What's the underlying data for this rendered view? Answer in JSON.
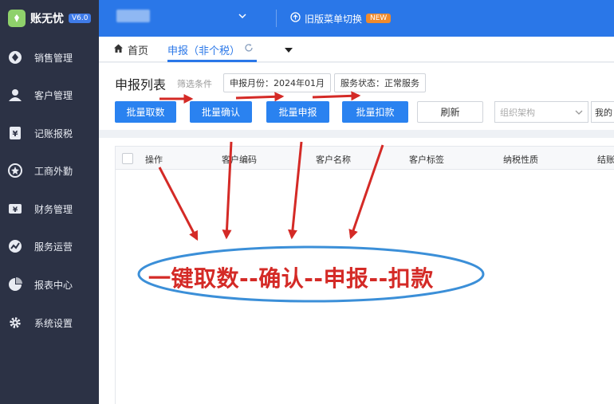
{
  "app": {
    "name": "账无忧",
    "version": "V6.0"
  },
  "sidebar": {
    "items": [
      {
        "label": "销售管理",
        "icon": "sales-icon"
      },
      {
        "label": "客户管理",
        "icon": "customer-icon"
      },
      {
        "label": "记账报税",
        "icon": "tax-icon"
      },
      {
        "label": "工商外勤",
        "icon": "field-icon"
      },
      {
        "label": "财务管理",
        "icon": "finance-icon"
      },
      {
        "label": "服务运营",
        "icon": "operations-icon"
      },
      {
        "label": "报表中心",
        "icon": "report-icon"
      },
      {
        "label": "系统设置",
        "icon": "settings-icon"
      }
    ]
  },
  "header": {
    "old_menu_label": "旧版菜单切换",
    "new_badge": "NEW"
  },
  "tabs": {
    "home": "首页",
    "active": "申报（非个税）"
  },
  "page": {
    "title": "申报列表",
    "filter_label": "筛选条件",
    "filter_month": "申报月份：2024年01月",
    "filter_status": "服务状态：正常服务"
  },
  "toolbar": {
    "batch_fetch": "批量取数",
    "batch_confirm": "批量确认",
    "batch_declare": "批量申报",
    "batch_deduct": "批量扣款",
    "refresh": "刷新",
    "org_placeholder": "组织架构",
    "mine_label": "我的"
  },
  "table": {
    "columns": [
      "操作",
      "客户编码",
      "客户名称",
      "客户标签",
      "纳税性质",
      "结账"
    ]
  },
  "annotation": {
    "text": "一键取数--确认--申报--扣款"
  },
  "colors": {
    "primary": "#2a77e8",
    "sidebar": "#2c3245",
    "annotation": "#d42a26"
  }
}
